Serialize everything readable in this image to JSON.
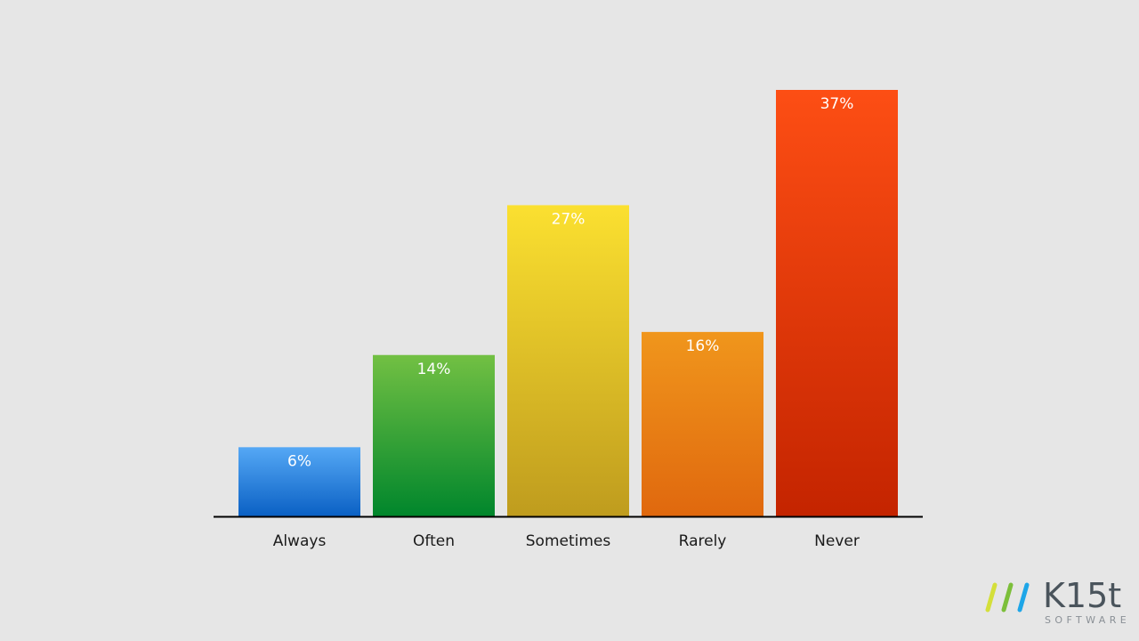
{
  "chart_data": {
    "type": "bar",
    "title": "",
    "xlabel": "",
    "ylabel": "",
    "categories": [
      "Always",
      "Often",
      "Sometimes",
      "Rarely",
      "Never"
    ],
    "values": [
      6,
      14,
      27,
      16,
      37
    ],
    "value_labels": [
      "6%",
      "14%",
      "27%",
      "16%",
      "37%"
    ],
    "unit": "%",
    "ylim": [
      0,
      37
    ],
    "grid": false,
    "legend": "none",
    "colors": [
      {
        "top": "#55a8f5",
        "bottom": "#0a60c4"
      },
      {
        "top": "#72c043",
        "bottom": "#00862c"
      },
      {
        "top": "#fbe030",
        "bottom": "#bf9c1e"
      },
      {
        "top": "#f0961c",
        "bottom": "#e0680e"
      },
      {
        "top": "#fd4e14",
        "bottom": "#c42400"
      }
    ]
  },
  "branding": {
    "logo_word": "K15t",
    "logo_sub": "SOFTWARE",
    "slash_colors": [
      "#d4df3a",
      "#7cbf3a",
      "#1ea6e8"
    ]
  }
}
